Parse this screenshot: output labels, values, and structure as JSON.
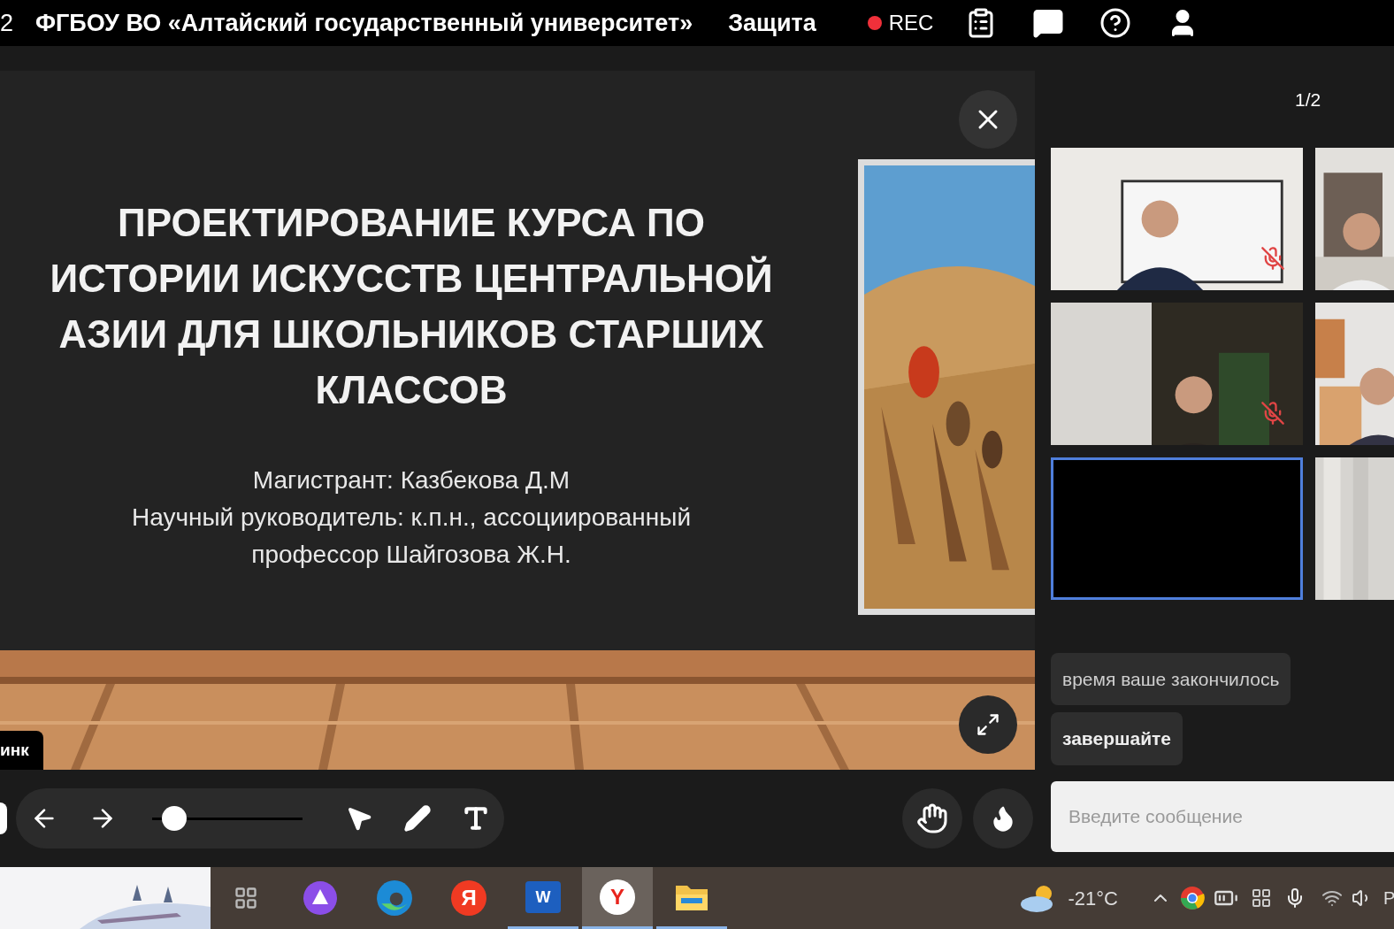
{
  "top_bar": {
    "cut_text": "2",
    "title": "ФГБОУ ВО «Алтайский государственный университет»",
    "section": "Защита",
    "recording": {
      "on": true,
      "label": "REC"
    }
  },
  "slide": {
    "title_lines": [
      "ПРОЕКТИРОВАНИЕ КУРСА ПО",
      "ИСТОРИИ ИСКУССТВ ЦЕНТРАЛЬНОЙ",
      "АЗИИ ДЛЯ ШКОЛЬНИКОВ СТАРШИХ",
      "КЛАССОВ"
    ],
    "subtitle_lines": [
      "Магистрант: Казбекова Д.М",
      "Научный руководитель: к.п.н., ассоциированный",
      "профессор Шайгозова Ж.Н."
    ]
  },
  "name_tag": "инк",
  "toolbar": {
    "zoom": {
      "level": 0.08
    }
  },
  "participants": {
    "page": "1/2",
    "tiles": [
      {
        "kind": "video",
        "muted": true,
        "selected": false
      },
      {
        "kind": "video",
        "muted": false,
        "selected": false
      },
      {
        "kind": "video",
        "muted": true,
        "selected": false
      },
      {
        "kind": "video",
        "muted": false,
        "selected": false
      },
      {
        "kind": "blank",
        "muted": false,
        "selected": true
      },
      {
        "kind": "video",
        "muted": false,
        "selected": false
      }
    ]
  },
  "chat": {
    "messages": [
      {
        "text": "время ваше закончилось",
        "bold": false
      },
      {
        "text": "завершайте",
        "bold": true
      }
    ],
    "input": {
      "placeholder": "Введите сообщение"
    }
  },
  "taskbar": {
    "apps": [
      {
        "kind": "taskview",
        "selected": false,
        "running": false
      },
      {
        "kind": "alice",
        "selected": false,
        "running": false
      },
      {
        "kind": "edge",
        "selected": false,
        "running": false
      },
      {
        "kind": "yandex",
        "glyph": "Я",
        "selected": false,
        "running": false
      },
      {
        "kind": "word",
        "glyph": "W",
        "selected": false,
        "running": true
      },
      {
        "kind": "ybrowser",
        "glyph": "Y",
        "selected": true,
        "running": true
      },
      {
        "kind": "explorer",
        "selected": false,
        "running": true
      }
    ],
    "temperature": "-21°C",
    "language_cut": "Р"
  }
}
